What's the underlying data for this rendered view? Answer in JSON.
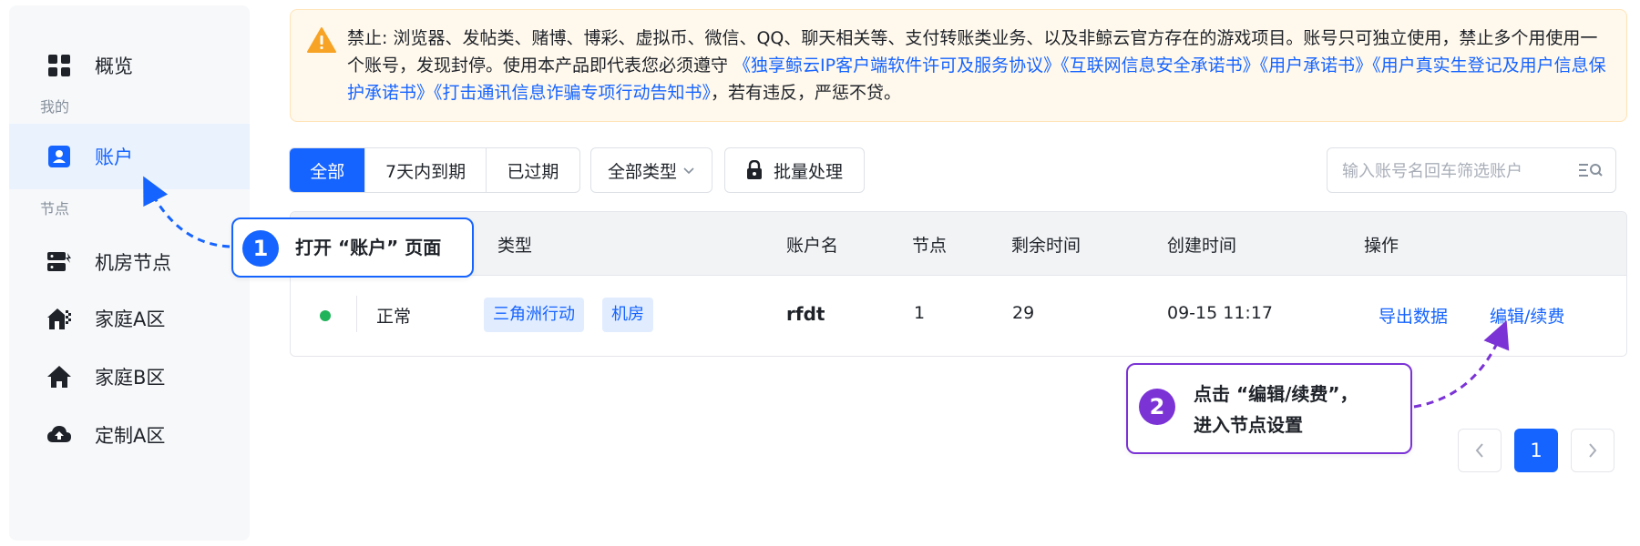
{
  "sidebar": {
    "items": [
      {
        "label": "概览",
        "icon": "dashboard-icon"
      },
      {
        "label": "账户",
        "icon": "user-card-icon",
        "active": true
      },
      {
        "label": "机房节点",
        "icon": "server-room-icon"
      },
      {
        "label": "家庭A区",
        "icon": "home-network-icon"
      },
      {
        "label": "家庭B区",
        "icon": "home-icon"
      },
      {
        "label": "定制A区",
        "icon": "cloud-upload-icon"
      }
    ],
    "groups": {
      "mine": "我的",
      "nodes": "节点"
    }
  },
  "notice": {
    "icon": "warning-icon",
    "text_part1": "禁止: 浏览器、发帖类、赌博、博彩、虚拟币、微信、QQ、聊天相关等、支付转账类业务、以及非鲸云官方存在的游戏项目。账号只可独立使用，禁止多个用使用一个账号，发现封停。使用本产品即代表您必须遵守 ",
    "links": [
      "《独享鲸云IP客户端软件许可及服务协议》",
      "《互联网信息安全承诺书》",
      "《用户承诺书》",
      "《用户真实生登记及用户信息保护承诺书》",
      "《打击通讯信息诈骗专项行动告知书》"
    ],
    "text_part2": "，若有违反，严惩不贷。"
  },
  "toolbar": {
    "tabs": [
      "全部",
      "7天内到期",
      "已过期"
    ],
    "active_tab": "全部",
    "type_filter": "全部类型",
    "batch_label": "批量处理",
    "search_placeholder": "输入账号名回车筛选账户"
  },
  "table": {
    "headers": {
      "type": "类型",
      "account": "账户名",
      "node": "节点",
      "remaining": "剩余时间",
      "created": "创建时间",
      "actions": "操作"
    },
    "rows": [
      {
        "status": "正常",
        "status_color": "#21b35a",
        "tags": [
          "三角洲行动",
          "机房"
        ],
        "account": "rfdt",
        "node": "1",
        "remaining": "29",
        "created": "09-15 11:17",
        "action_export": "导出数据",
        "action_edit": "编辑/续费"
      }
    ]
  },
  "callouts": [
    {
      "number": "1",
      "text": "打开 “账户” 页面",
      "color": "#1664ff"
    },
    {
      "number": "2",
      "line1": "点击 “编辑/续费”，",
      "line2": "进入节点设置",
      "color": "#7b33d6"
    }
  ],
  "pagination": {
    "current": "1",
    "prev_icon": "chevron-left-icon",
    "next_icon": "chevron-right-icon"
  },
  "colors": {
    "accent": "#1664ff",
    "callout2": "#7b33d6",
    "warning": "#f7a325"
  }
}
